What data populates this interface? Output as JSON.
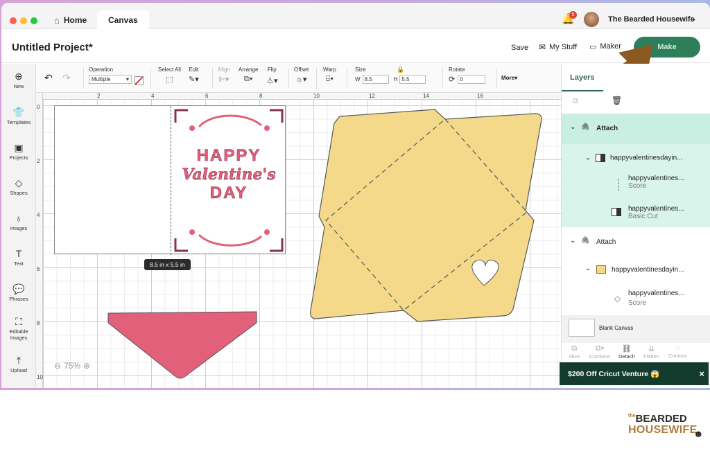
{
  "window": {
    "tabs": [
      {
        "label": "Home"
      },
      {
        "label": "Canvas"
      }
    ],
    "notification_count": "5",
    "user_name": "The Bearded Housewife"
  },
  "header": {
    "project_title": "Untitled Project*",
    "save_label": "Save",
    "my_stuff_label": "My Stuff",
    "machine_label": "Maker",
    "make_label": "Make"
  },
  "sidebar": {
    "items": [
      {
        "label": "New",
        "icon": "plus-circle-icon"
      },
      {
        "label": "Templates",
        "icon": "shirt-icon"
      },
      {
        "label": "Projects",
        "icon": "projects-icon"
      },
      {
        "label": "Shapes",
        "icon": "shapes-icon"
      },
      {
        "label": "Images",
        "icon": "bulb-icon"
      },
      {
        "label": "Text",
        "icon": "text-icon"
      },
      {
        "label": "Phrases",
        "icon": "speech-icon"
      },
      {
        "label": "Editable Images",
        "icon": "editable-icon"
      },
      {
        "label": "Upload",
        "icon": "upload-icon"
      }
    ]
  },
  "toolbar": {
    "operation_label": "Operation",
    "operation_value": "Multiple",
    "select_all_label": "Select All",
    "edit_label": "Edit",
    "align_label": "Align",
    "arrange_label": "Arrange",
    "flip_label": "Flip",
    "offset_label": "Offset",
    "warp_label": "Warp",
    "size_label": "Size",
    "w_label": "W",
    "w_value": "8.5",
    "h_label": "H",
    "h_value": "5.5",
    "rotate_label": "Rotate",
    "rotate_value": "0",
    "more_label": "More"
  },
  "ruler": {
    "top": [
      "2",
      "4",
      "6",
      "8",
      "10",
      "12",
      "14",
      "16"
    ],
    "left": [
      "0",
      "2",
      "4",
      "6",
      "8",
      "10"
    ]
  },
  "canvas": {
    "size_tag": "8.5  in x 5.5  in",
    "zoom": "75%",
    "card_text": {
      "line1": "HAPPY",
      "line2": "Valentine's",
      "line3": "DAY"
    },
    "colors": {
      "pink": "#e2607a",
      "envelope": "#f5d98b",
      "teal": "#7fd3c0"
    }
  },
  "layers": {
    "tabs": [
      "Layers"
    ],
    "rows": [
      {
        "label": "Attach",
        "type": "group"
      },
      {
        "label": "happyvalentinesdayin...",
        "type": "sub"
      },
      {
        "label": "happyvalentines...",
        "sub": "Score",
        "type": "item"
      },
      {
        "label": "happyvalentines...",
        "sub": "Basic Cut",
        "type": "item"
      },
      {
        "label": "Attach",
        "type": "group"
      },
      {
        "label": "happyvalentinesdayin...",
        "type": "sub"
      },
      {
        "label": "happyvalentines...",
        "sub": "Score",
        "type": "item"
      }
    ],
    "blank_canvas": "Blank Canvas",
    "actions": [
      "Slice",
      "Combine",
      "Detach",
      "Flatten",
      "Contour"
    ]
  },
  "promo": {
    "text": "$200 Off Cricut Venture 😱",
    "close": "×"
  },
  "watermark": {
    "line1": "BEARDED",
    "line2": "HOUSEWIFE",
    "prefix": "the"
  }
}
